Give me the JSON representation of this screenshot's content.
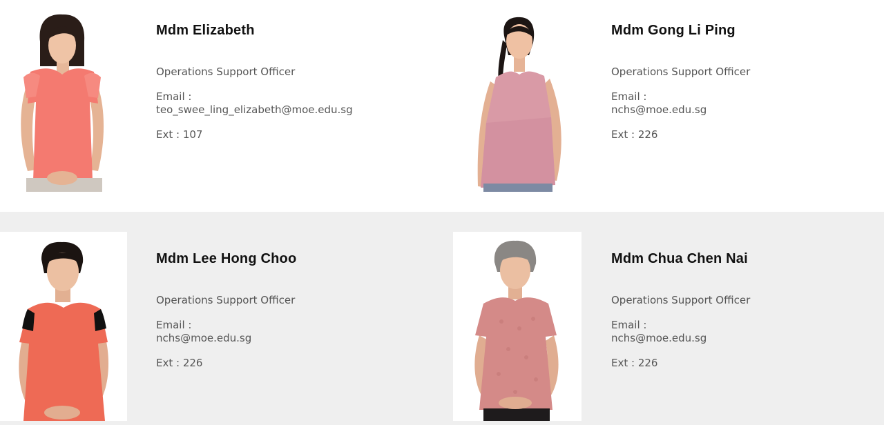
{
  "staff": [
    {
      "name": "Mdm Elizabeth",
      "role": "Operations Support Officer",
      "email_label": "Email :",
      "email": "teo_swee_ling_elizabeth@moe.edu.sg",
      "ext": "Ext : 107"
    },
    {
      "name": "Mdm Gong Li Ping",
      "role": "Operations Support Officer",
      "email_label": "Email :",
      "email": "nchs@moe.edu.sg",
      "ext": "Ext : 226"
    },
    {
      "name": "Mdm Lee Hong Choo",
      "role": "Operations Support Officer",
      "email_label": "Email :",
      "email": "nchs@moe.edu.sg",
      "ext": "Ext : 226"
    },
    {
      "name": "Mdm Chua Chen Nai",
      "role": "Operations Support Officer",
      "email_label": "Email :",
      "email": "nchs@moe.edu.sg",
      "ext": "Ext : 226"
    }
  ],
  "colors": {
    "section_alt_bg": "#efefef",
    "blouse_coral": "#f47a70",
    "blouse_pink": "#d99aa6",
    "blouse_red": "#ee6a55",
    "blouse_rose": "#d48a88"
  }
}
